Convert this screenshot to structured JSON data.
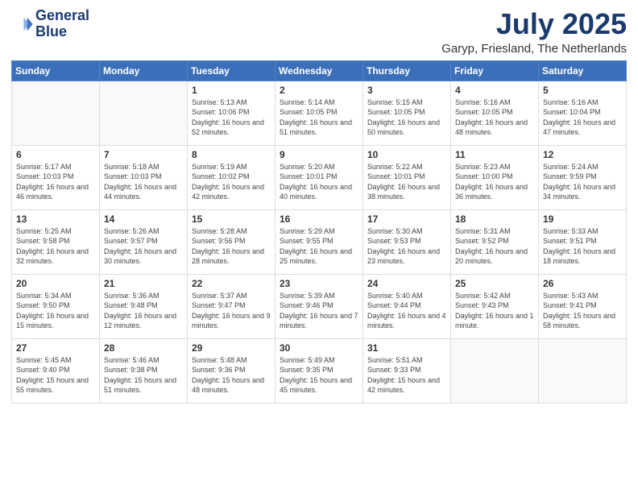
{
  "logo": {
    "line1": "General",
    "line2": "Blue"
  },
  "header": {
    "month": "July 2025",
    "location": "Garyp, Friesland, The Netherlands"
  },
  "weekdays": [
    "Sunday",
    "Monday",
    "Tuesday",
    "Wednesday",
    "Thursday",
    "Friday",
    "Saturday"
  ],
  "weeks": [
    [
      {
        "day": "",
        "sunrise": "",
        "sunset": "",
        "daylight": ""
      },
      {
        "day": "",
        "sunrise": "",
        "sunset": "",
        "daylight": ""
      },
      {
        "day": "1",
        "sunrise": "Sunrise: 5:13 AM",
        "sunset": "Sunset: 10:06 PM",
        "daylight": "Daylight: 16 hours and 52 minutes."
      },
      {
        "day": "2",
        "sunrise": "Sunrise: 5:14 AM",
        "sunset": "Sunset: 10:05 PM",
        "daylight": "Daylight: 16 hours and 51 minutes."
      },
      {
        "day": "3",
        "sunrise": "Sunrise: 5:15 AM",
        "sunset": "Sunset: 10:05 PM",
        "daylight": "Daylight: 16 hours and 50 minutes."
      },
      {
        "day": "4",
        "sunrise": "Sunrise: 5:16 AM",
        "sunset": "Sunset: 10:05 PM",
        "daylight": "Daylight: 16 hours and 48 minutes."
      },
      {
        "day": "5",
        "sunrise": "Sunrise: 5:16 AM",
        "sunset": "Sunset: 10:04 PM",
        "daylight": "Daylight: 16 hours and 47 minutes."
      }
    ],
    [
      {
        "day": "6",
        "sunrise": "Sunrise: 5:17 AM",
        "sunset": "Sunset: 10:03 PM",
        "daylight": "Daylight: 16 hours and 46 minutes."
      },
      {
        "day": "7",
        "sunrise": "Sunrise: 5:18 AM",
        "sunset": "Sunset: 10:03 PM",
        "daylight": "Daylight: 16 hours and 44 minutes."
      },
      {
        "day": "8",
        "sunrise": "Sunrise: 5:19 AM",
        "sunset": "Sunset: 10:02 PM",
        "daylight": "Daylight: 16 hours and 42 minutes."
      },
      {
        "day": "9",
        "sunrise": "Sunrise: 5:20 AM",
        "sunset": "Sunset: 10:01 PM",
        "daylight": "Daylight: 16 hours and 40 minutes."
      },
      {
        "day": "10",
        "sunrise": "Sunrise: 5:22 AM",
        "sunset": "Sunset: 10:01 PM",
        "daylight": "Daylight: 16 hours and 38 minutes."
      },
      {
        "day": "11",
        "sunrise": "Sunrise: 5:23 AM",
        "sunset": "Sunset: 10:00 PM",
        "daylight": "Daylight: 16 hours and 36 minutes."
      },
      {
        "day": "12",
        "sunrise": "Sunrise: 5:24 AM",
        "sunset": "Sunset: 9:59 PM",
        "daylight": "Daylight: 16 hours and 34 minutes."
      }
    ],
    [
      {
        "day": "13",
        "sunrise": "Sunrise: 5:25 AM",
        "sunset": "Sunset: 9:58 PM",
        "daylight": "Daylight: 16 hours and 32 minutes."
      },
      {
        "day": "14",
        "sunrise": "Sunrise: 5:26 AM",
        "sunset": "Sunset: 9:57 PM",
        "daylight": "Daylight: 16 hours and 30 minutes."
      },
      {
        "day": "15",
        "sunrise": "Sunrise: 5:28 AM",
        "sunset": "Sunset: 9:56 PM",
        "daylight": "Daylight: 16 hours and 28 minutes."
      },
      {
        "day": "16",
        "sunrise": "Sunrise: 5:29 AM",
        "sunset": "Sunset: 9:55 PM",
        "daylight": "Daylight: 16 hours and 25 minutes."
      },
      {
        "day": "17",
        "sunrise": "Sunrise: 5:30 AM",
        "sunset": "Sunset: 9:53 PM",
        "daylight": "Daylight: 16 hours and 23 minutes."
      },
      {
        "day": "18",
        "sunrise": "Sunrise: 5:31 AM",
        "sunset": "Sunset: 9:52 PM",
        "daylight": "Daylight: 16 hours and 20 minutes."
      },
      {
        "day": "19",
        "sunrise": "Sunrise: 5:33 AM",
        "sunset": "Sunset: 9:51 PM",
        "daylight": "Daylight: 16 hours and 18 minutes."
      }
    ],
    [
      {
        "day": "20",
        "sunrise": "Sunrise: 5:34 AM",
        "sunset": "Sunset: 9:50 PM",
        "daylight": "Daylight: 16 hours and 15 minutes."
      },
      {
        "day": "21",
        "sunrise": "Sunrise: 5:36 AM",
        "sunset": "Sunset: 9:48 PM",
        "daylight": "Daylight: 16 hours and 12 minutes."
      },
      {
        "day": "22",
        "sunrise": "Sunrise: 5:37 AM",
        "sunset": "Sunset: 9:47 PM",
        "daylight": "Daylight: 16 hours and 9 minutes."
      },
      {
        "day": "23",
        "sunrise": "Sunrise: 5:39 AM",
        "sunset": "Sunset: 9:46 PM",
        "daylight": "Daylight: 16 hours and 7 minutes."
      },
      {
        "day": "24",
        "sunrise": "Sunrise: 5:40 AM",
        "sunset": "Sunset: 9:44 PM",
        "daylight": "Daylight: 16 hours and 4 minutes."
      },
      {
        "day": "25",
        "sunrise": "Sunrise: 5:42 AM",
        "sunset": "Sunset: 9:43 PM",
        "daylight": "Daylight: 16 hours and 1 minute."
      },
      {
        "day": "26",
        "sunrise": "Sunrise: 5:43 AM",
        "sunset": "Sunset: 9:41 PM",
        "daylight": "Daylight: 15 hours and 58 minutes."
      }
    ],
    [
      {
        "day": "27",
        "sunrise": "Sunrise: 5:45 AM",
        "sunset": "Sunset: 9:40 PM",
        "daylight": "Daylight: 15 hours and 55 minutes."
      },
      {
        "day": "28",
        "sunrise": "Sunrise: 5:46 AM",
        "sunset": "Sunset: 9:38 PM",
        "daylight": "Daylight: 15 hours and 51 minutes."
      },
      {
        "day": "29",
        "sunrise": "Sunrise: 5:48 AM",
        "sunset": "Sunset: 9:36 PM",
        "daylight": "Daylight: 15 hours and 48 minutes."
      },
      {
        "day": "30",
        "sunrise": "Sunrise: 5:49 AM",
        "sunset": "Sunset: 9:35 PM",
        "daylight": "Daylight: 15 hours and 45 minutes."
      },
      {
        "day": "31",
        "sunrise": "Sunrise: 5:51 AM",
        "sunset": "Sunset: 9:33 PM",
        "daylight": "Daylight: 15 hours and 42 minutes."
      },
      {
        "day": "",
        "sunrise": "",
        "sunset": "",
        "daylight": ""
      },
      {
        "day": "",
        "sunrise": "",
        "sunset": "",
        "daylight": ""
      }
    ]
  ]
}
